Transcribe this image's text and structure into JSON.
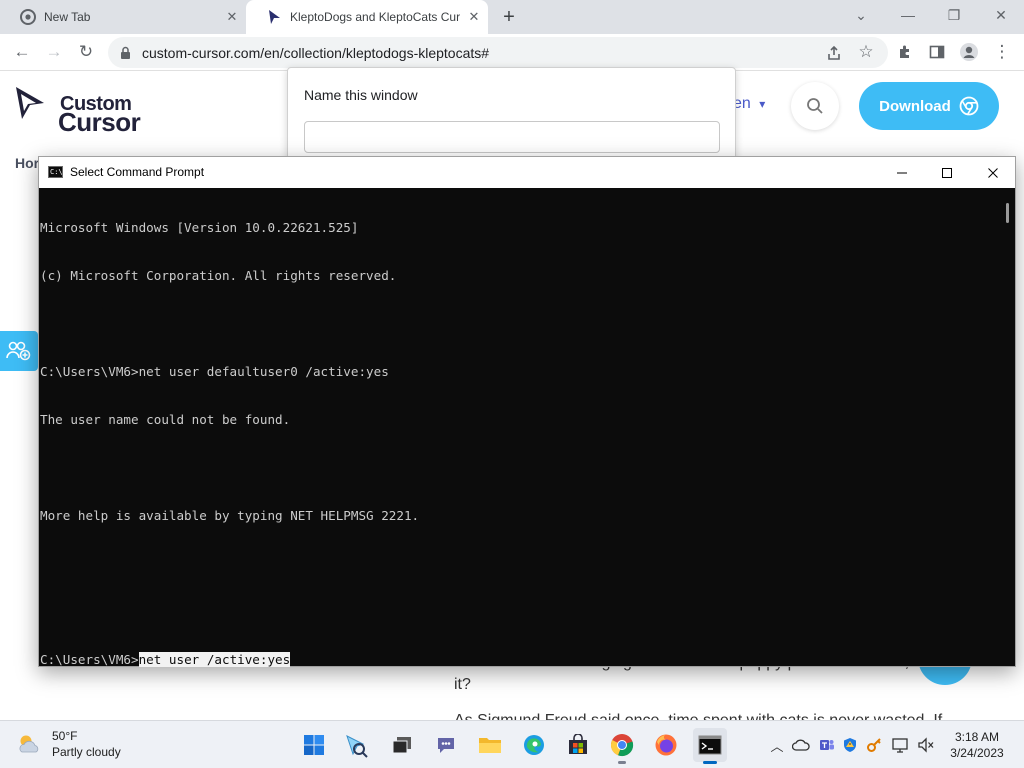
{
  "browser": {
    "tabs": [
      {
        "title": "New Tab",
        "favicon": "chrome-icon",
        "active": false
      },
      {
        "title": "KleptoDogs and KleptoCats Curs",
        "favicon": "custom-cursor-favicon",
        "active": true
      }
    ],
    "url": "custom-cursor.com/en/collection/kleptodogs-kleptocats#"
  },
  "site": {
    "logo_line1": "Custom",
    "logo_line2": "Cursor",
    "language": "en",
    "download_label": "Download",
    "breadcrumb": "Hor",
    "article_line1": "can have a blast hanging out with these puppy pals. PAW-some,",
    "article_line2": "it?",
    "article_line3": "As Sigmund Freud said once, time spent with cats is never wasted. If",
    "accent_color": "#3ebcf5"
  },
  "name_window_popup": {
    "title": "Name this window",
    "input_value": ""
  },
  "cmd": {
    "title": "Select Command Prompt",
    "lines": [
      "Microsoft Windows [Version 10.0.22621.525]",
      "(c) Microsoft Corporation. All rights reserved.",
      "",
      "C:\\Users\\VM6>net user defaultuser0 /active:yes",
      "The user name could not be found.",
      "",
      "More help is available by typing NET HELPMSG 2221.",
      "",
      ""
    ],
    "prompt": "C:\\Users\\VM6>",
    "selected_command": "net user /active:yes"
  },
  "taskbar": {
    "weather_temp": "50°F",
    "weather_desc": "Partly cloudy",
    "apps": [
      "start-icon",
      "search-icon",
      "task-view-icon",
      "teams-chat-icon",
      "file-explorer-icon",
      "edge-icon",
      "store-icon",
      "chrome-icon",
      "firefox-icon",
      "terminal-icon"
    ],
    "time": "3:18 AM",
    "date": "3/24/2023"
  }
}
